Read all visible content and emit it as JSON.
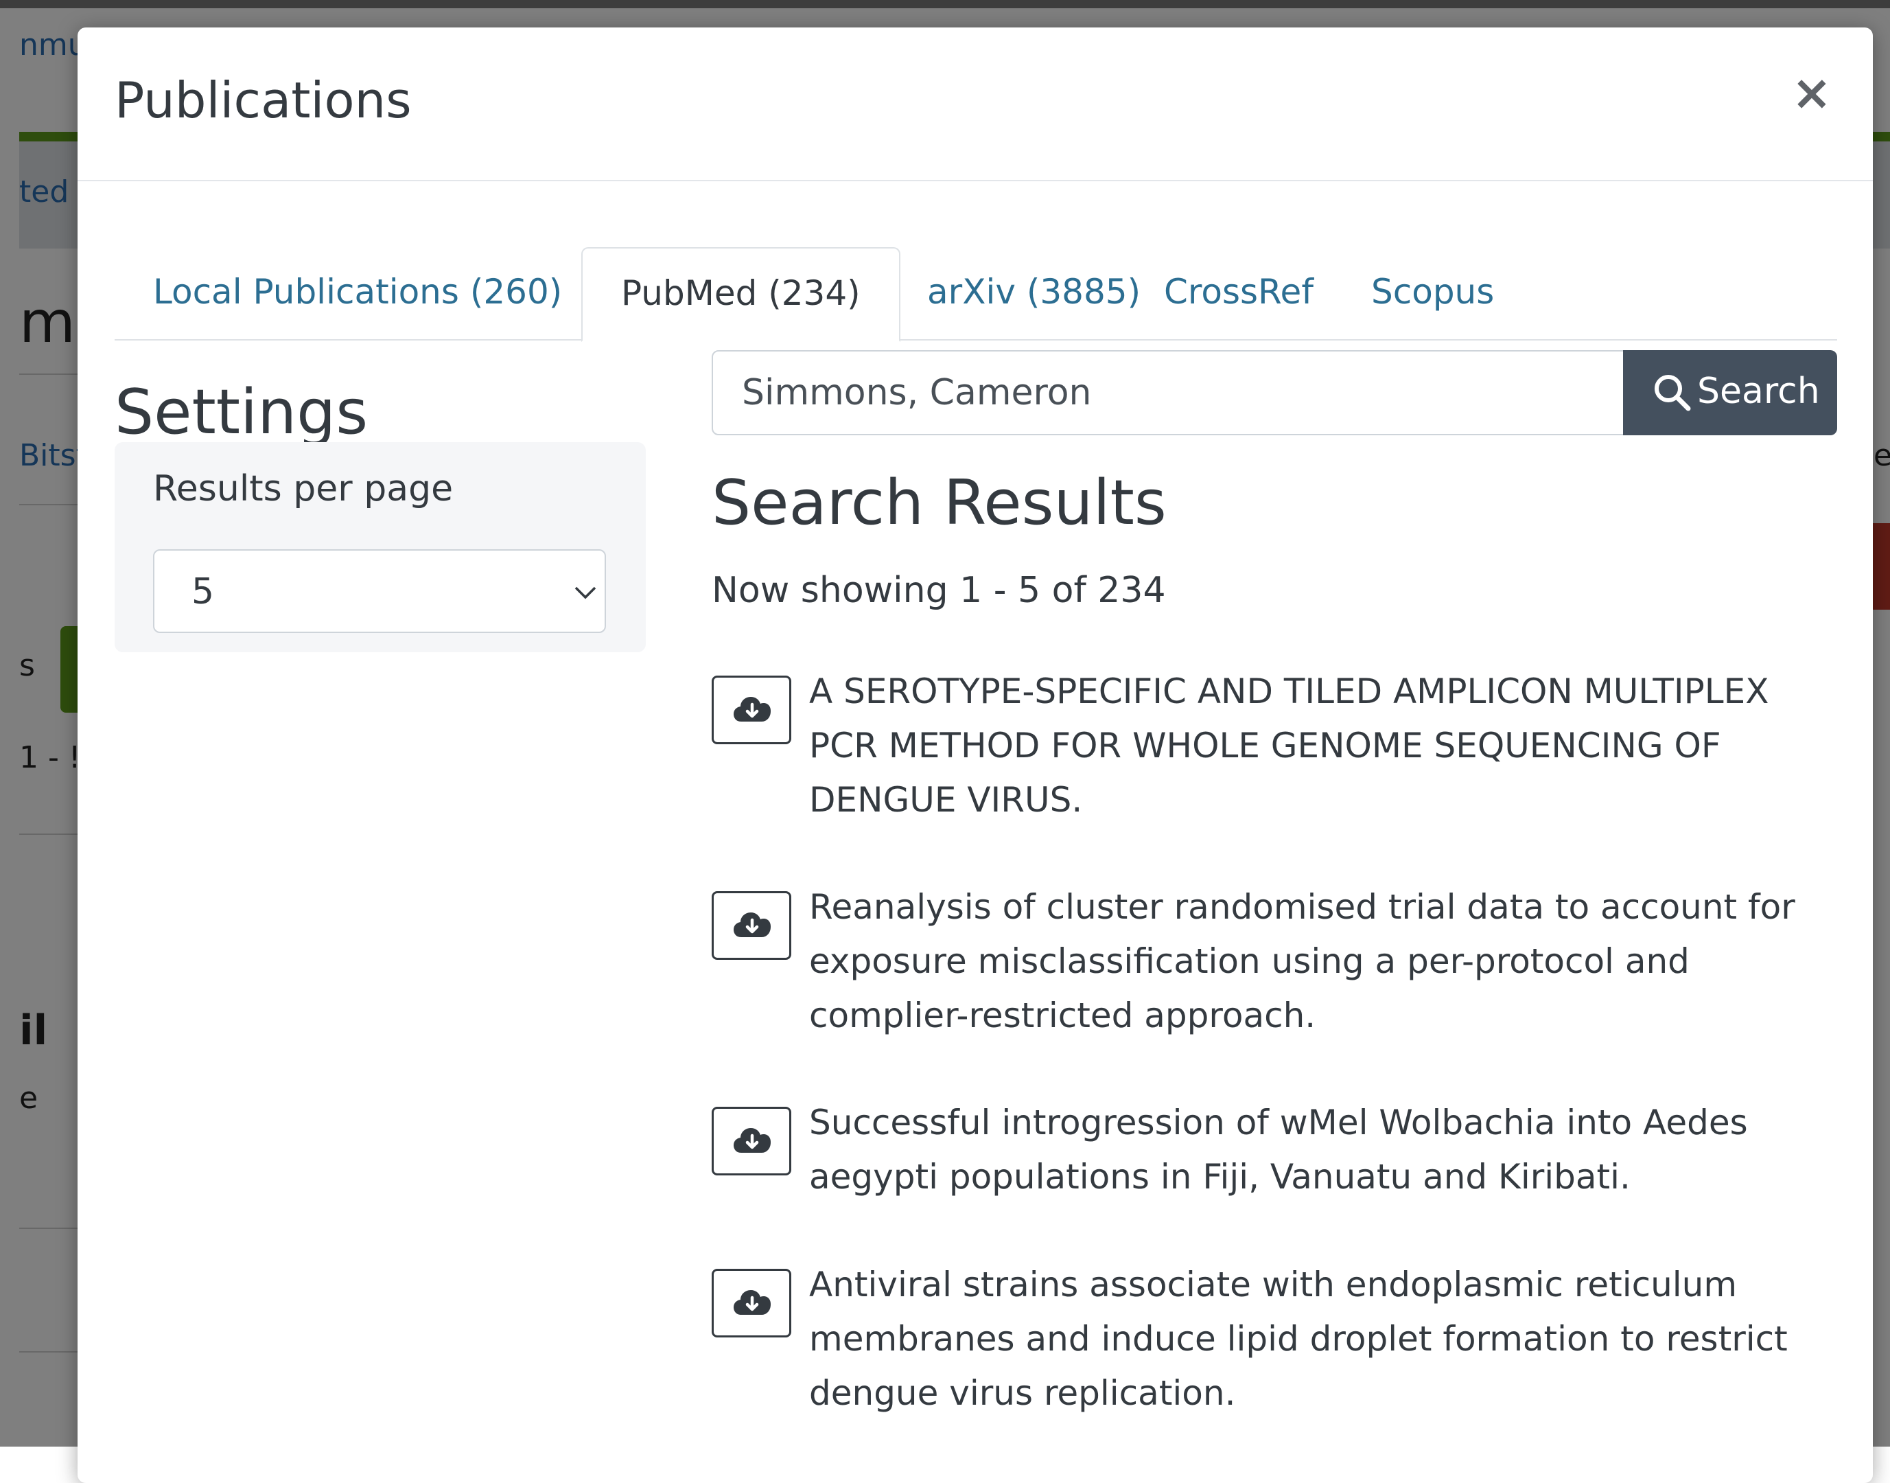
{
  "background": {
    "fragments": [
      "nmu",
      "ted",
      "m",
      "Bitst",
      "s",
      "1 - !",
      "il",
      "e",
      "er"
    ]
  },
  "modal": {
    "title": "Publications",
    "close_label": "×"
  },
  "tabs": [
    {
      "label": "Local Publications (260)",
      "active": false
    },
    {
      "label": "PubMed (234)",
      "active": true
    },
    {
      "label": "arXiv (3885)",
      "active": false
    },
    {
      "label": "CrossRef",
      "active": false
    },
    {
      "label": "Scopus",
      "active": false
    }
  ],
  "settings": {
    "title": "Settings",
    "results_per_page_label": "Results per page",
    "results_per_page_value": "5"
  },
  "search": {
    "query": "Simmons, Cameron",
    "button_label": "Search"
  },
  "results": {
    "title": "Search Results",
    "count_text": "Now showing 1 - 5 of 234",
    "items": [
      {
        "title": "A SEROTYPE-SPECIFIC AND TILED AMPLICON MULTIPLEX PCR METHOD FOR WHOLE GENOME SEQUENCING OF DENGUE VIRUS."
      },
      {
        "title": "Reanalysis of cluster randomised trial data to account for exposure misclassification using a per-protocol and complier-restricted approach."
      },
      {
        "title": "Successful introgression of wMel Wolbachia into Aedes aegypti populations in Fiji, Vanuatu and Kiribati."
      },
      {
        "title": "Antiviral strains associate with endoplasmic reticulum membranes and induce lipid droplet formation to restrict dengue virus replication."
      }
    ]
  },
  "colors": {
    "tab_link": "#2c6e92",
    "search_button": "#44505e",
    "overlay": "rgba(0,0,0,0.5)",
    "bg_green": "#5c9a1b"
  }
}
